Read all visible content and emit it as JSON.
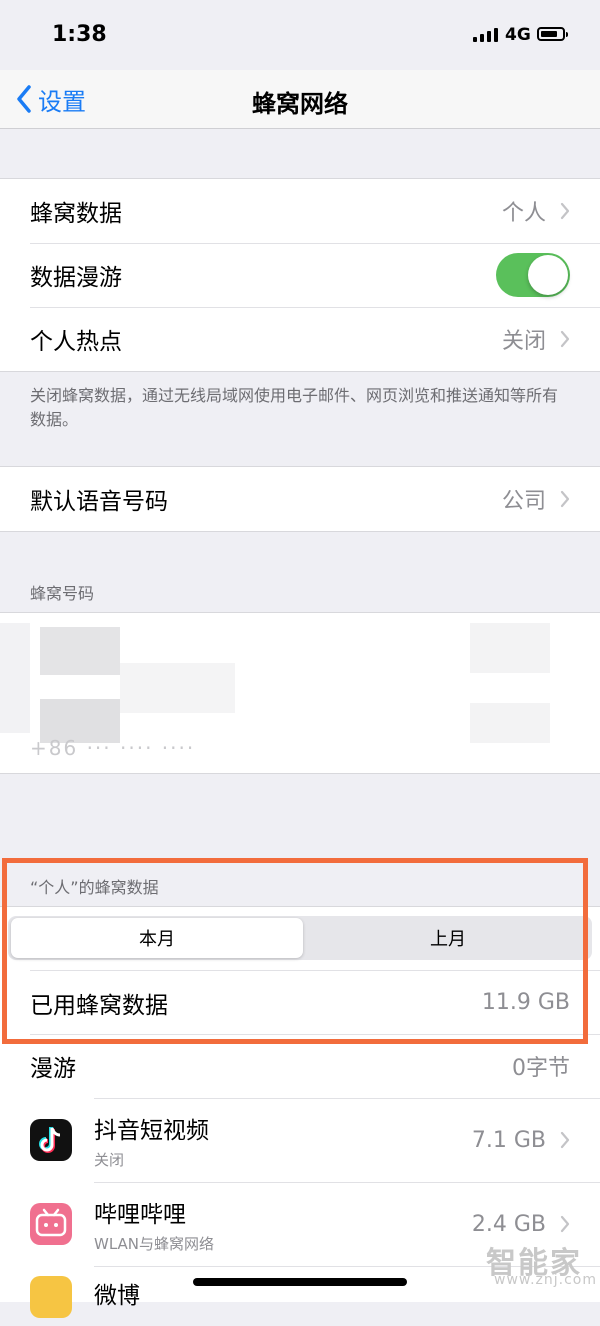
{
  "status_bar": {
    "time": "1:38",
    "network": "4G"
  },
  "nav": {
    "back_label": "设置",
    "title": "蜂窝网络"
  },
  "group1": {
    "cellular_data": {
      "label": "蜂窝数据",
      "value": "个人"
    },
    "data_roaming": {
      "label": "数据漫游",
      "enabled": true
    },
    "hotspot": {
      "label": "个人热点",
      "value": "关闭"
    }
  },
  "footnote": "关闭蜂窝数据，通过无线局域网使用电子邮件、网页浏览和推送通知等所有数据。",
  "default_voice": {
    "label": "默认语音号码",
    "value": "公司"
  },
  "cellular_numbers": {
    "header": "蜂窝号码",
    "masked_number": "+86 ··· ···· ····"
  },
  "usage": {
    "header": "“个人”的蜂窝数据",
    "segments": [
      "本月",
      "上月"
    ],
    "selected_segment": "本月",
    "used_label": "已用蜂窝数据",
    "used_value": "11.9 GB",
    "roaming_label": "漫游",
    "roaming_value": "0字节"
  },
  "apps": [
    {
      "name": "抖音短视频",
      "sub": "关闭",
      "usage": "7.1 GB",
      "icon": "douyin-icon",
      "icon_color": "#111111"
    },
    {
      "name": "哔哩哔哩",
      "sub": "WLAN与蜂窝网络",
      "usage": "2.4 GB",
      "icon": "bilibili-icon",
      "icon_color": "#f0708f"
    },
    {
      "name": "微博",
      "sub": "",
      "usage": "",
      "icon": "weibo-icon",
      "icon_color": "#f6c543"
    }
  ],
  "watermark": {
    "text": "智能家",
    "url": "www.znj.com"
  },
  "colors": {
    "accent": "#1a7cf5",
    "toggle_on": "#5ac05b",
    "highlight": "#f26c3c"
  }
}
